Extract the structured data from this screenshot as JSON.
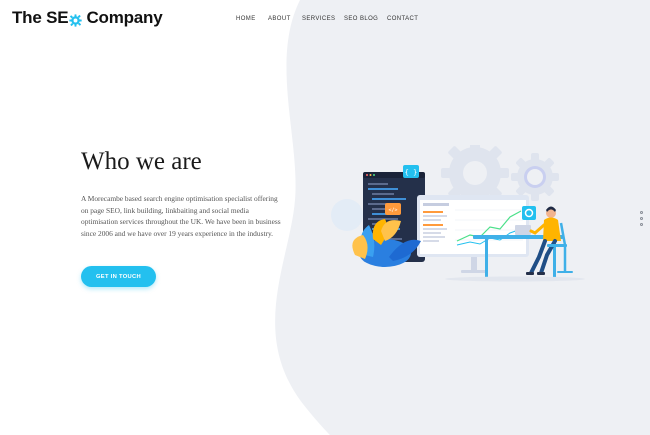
{
  "header": {
    "logo": {
      "part1": "The SE",
      "part2": "Company",
      "gear_icon": "gear-icon",
      "brand_color": "#23c0ef"
    },
    "nav": [
      {
        "label": "HOME"
      },
      {
        "label": "ABOUT"
      },
      {
        "label": "SERVICES"
      },
      {
        "label": "SEO BLOG"
      },
      {
        "label": "CONTACT"
      }
    ]
  },
  "hero": {
    "title": "Who we are",
    "text": "A Morecambe based search engine optimisation specialist offering on page SEO, link building, linkbaiting and social media optimisation services throughout the UK. We have been in business since 2006 and we have over 19 years experience in the industry.",
    "cta_label": "GET IN TOUCH",
    "cta_color": "#23c0ef",
    "illustration": "seo-team-illustration"
  },
  "slider_dots": {
    "count": 3
  },
  "colors": {
    "background_shape": "#eef0f4",
    "text": "#1b1b1b"
  }
}
